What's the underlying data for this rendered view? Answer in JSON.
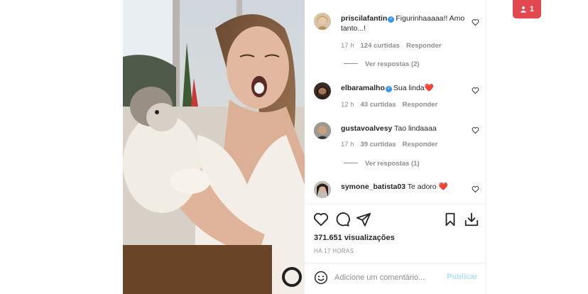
{
  "comments": [
    {
      "username": "priscilafantin",
      "verified": true,
      "text": "Figurinhaaaaa!! Amo tanto...!",
      "time": "17 h",
      "likes": "124 curtidas",
      "reply_label": "Responder",
      "view_replies": "Ver respostas (2)"
    },
    {
      "username": "elbaramalho",
      "verified": true,
      "text": "Sua linda❤️",
      "time": "12 h",
      "likes": "43 curtidas",
      "reply_label": "Responder"
    },
    {
      "username": "gustavoalvesy",
      "verified": false,
      "text": "Tao lindaaaa",
      "time": "17 h",
      "likes": "39 curtidas",
      "reply_label": "Responder",
      "view_replies": "Ver respostas (1)"
    },
    {
      "username": "symone_batista03",
      "verified": false,
      "text": "Te adoro ❤️"
    }
  ],
  "post": {
    "views": "371.651 visualizações",
    "time_ago": "HÁ 17 HORAS"
  },
  "add_comment": {
    "placeholder": "Adicione um comentário...",
    "publish_label": "Publicar"
  },
  "viewer_badge": {
    "count": "1"
  },
  "icons": {
    "like": "heart-icon",
    "comment": "comment-bubble-icon",
    "share": "paper-plane-icon",
    "save": "bookmark-icon",
    "download": "download-icon",
    "emoji": "smiley-icon",
    "viewer": "person-icon",
    "verified": "verified-badge-icon"
  },
  "colors": {
    "verified": "#3897f0",
    "heart_red": "#ed4956",
    "publish_disabled": "#b2dffc",
    "badge": "#e3474f"
  }
}
